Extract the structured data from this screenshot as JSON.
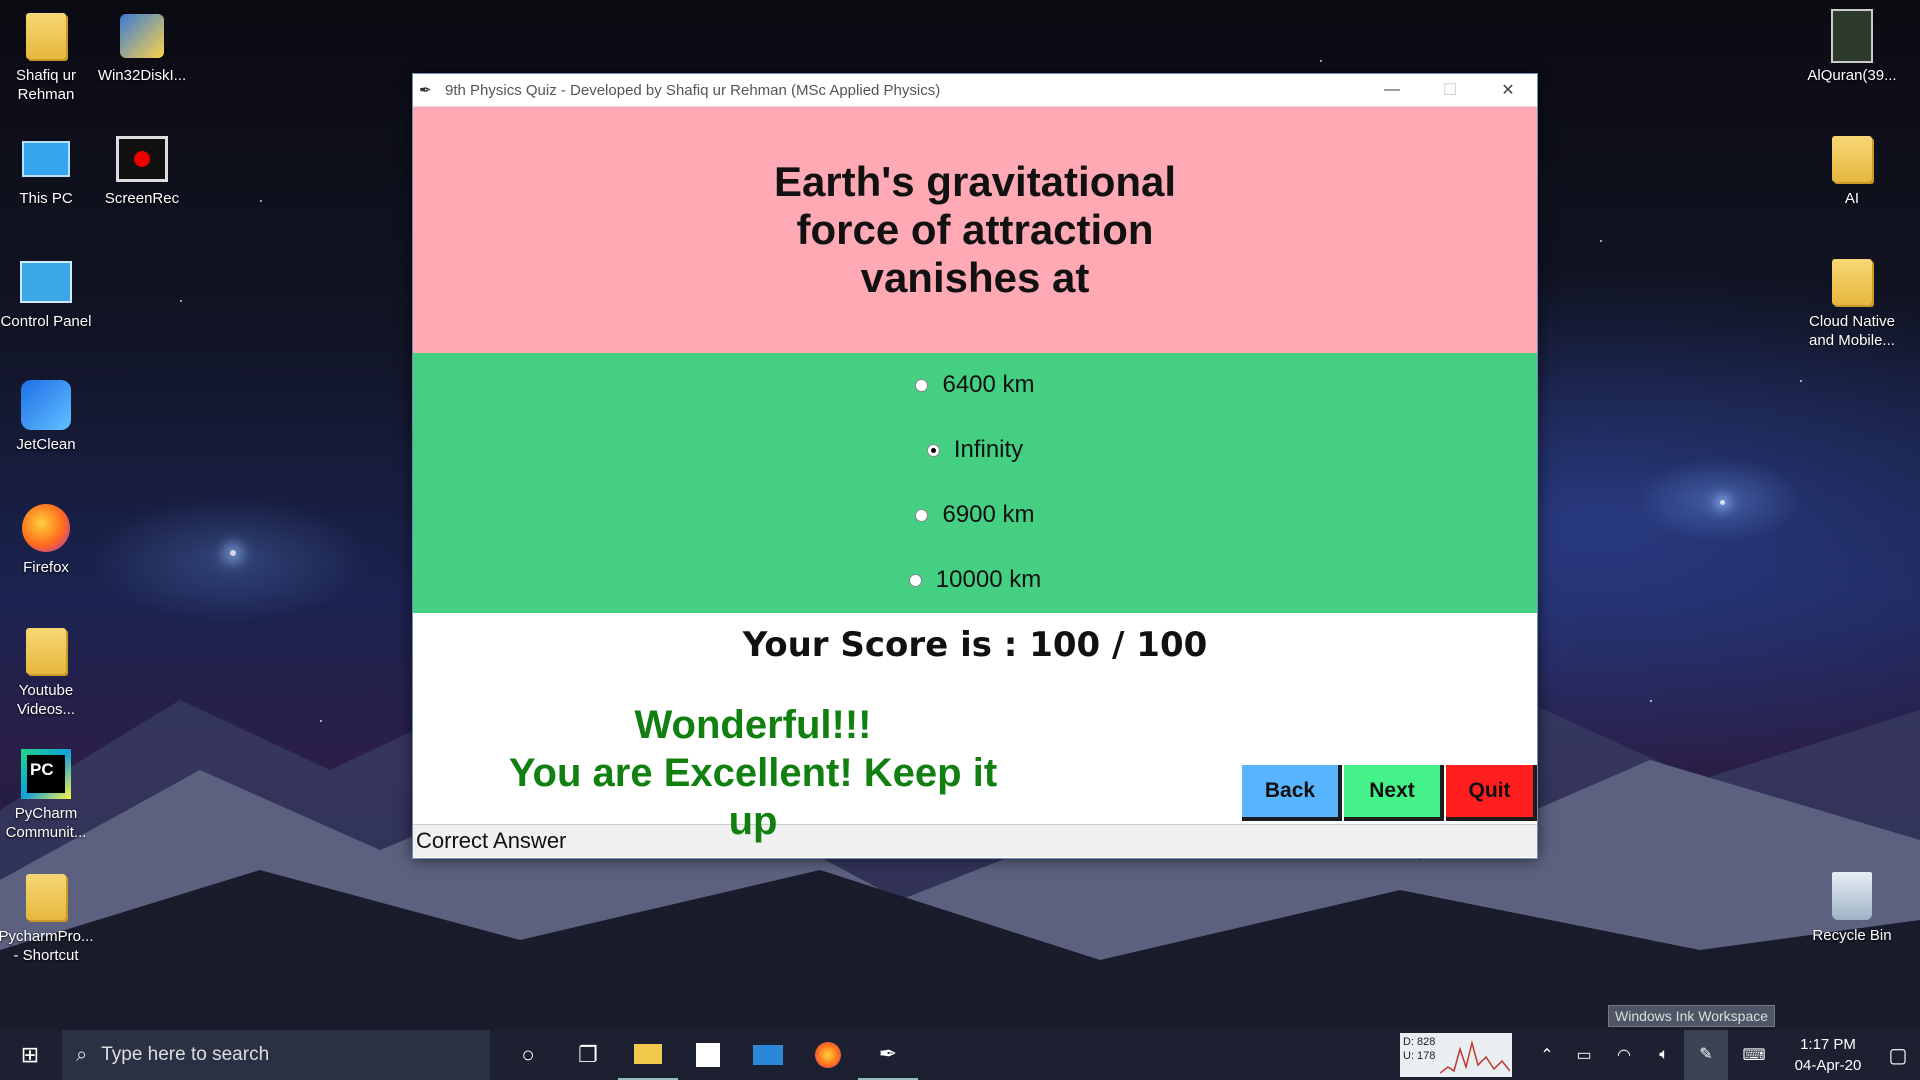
{
  "desktop": {
    "left_icons": [
      {
        "label": "Shafiq ur Rehman",
        "icon": "user-folder-icon"
      },
      {
        "label": "Win32DiskI...",
        "icon": "disk-imager-icon"
      },
      {
        "label": "This PC",
        "icon": "computer-icon"
      },
      {
        "label": "ScreenRec",
        "icon": "screen-recorder-icon"
      },
      {
        "label": "Control Panel",
        "icon": "control-panel-icon"
      },
      {
        "label": "JetClean",
        "icon": "jetclean-icon"
      },
      {
        "label": "Firefox",
        "icon": "firefox-icon"
      },
      {
        "label": "Youtube Videos...",
        "icon": "folder-icon"
      },
      {
        "label": "PyCharm Communit...",
        "icon": "pycharm-icon"
      },
      {
        "label": "PycharmPro... - Shortcut",
        "icon": "folder-icon"
      }
    ],
    "right_icons": [
      {
        "label": "AlQuran(39...",
        "icon": "pdf-book-icon"
      },
      {
        "label": "AI",
        "icon": "folder-icon"
      },
      {
        "label": "Cloud Native and Mobile...",
        "icon": "folder-icon"
      },
      {
        "label": "Recycle Bin",
        "icon": "recycle-bin-icon"
      }
    ]
  },
  "window": {
    "title": "9th Physics Quiz - Developed by Shafiq ur Rehman (MSc Applied Physics)",
    "question": "Earth's gravitational force of attraction vanishes at",
    "options": [
      "6400 km",
      "Infinity",
      "6900 km",
      "10000 km"
    ],
    "selected_option": "Infinity",
    "score_text": "Your Score is : 100 / 100",
    "message_line1": "Wonderful!!!",
    "message_line2": "You are Excellent! Keep it up",
    "buttons": {
      "back": "Back",
      "next": "Next",
      "quit": "Quit"
    },
    "button_colors": {
      "back": "#59b4ff",
      "next": "#45f28a",
      "quit": "#ff1f1f"
    },
    "status": "Correct Answer",
    "colors": {
      "question_bg": "#ffa9b5",
      "options_bg": "#45cf82",
      "message": "#118011"
    }
  },
  "taskbar": {
    "search_placeholder": "Type here to search",
    "net_down": "D: 828",
    "net_up": "U: 178",
    "time": "1:17 PM",
    "date": "04-Apr-20",
    "ink_tooltip": "Windows Ink Workspace"
  }
}
